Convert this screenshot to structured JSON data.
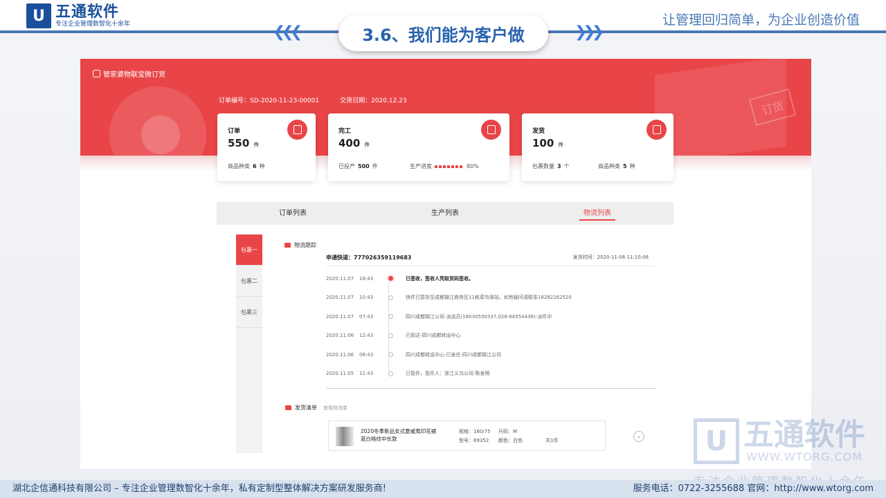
{
  "header": {
    "logo_mark": "U",
    "logo_name": "五通软件",
    "logo_sub": "专注企业管理数智化十余年",
    "slogan": "让管理回归简单，为企业创造价值",
    "title": "3.6、我们能为客户做",
    "chev_left": "❮❮❮",
    "chev_right": "❯❯❯"
  },
  "app": {
    "title": "管家婆物联宝微订货",
    "order_no": "订单编号：SD-2020-11-23-00001",
    "delivery_date": "交货日期：2020.12.23",
    "deco_tag": "订货",
    "cards": [
      {
        "label": "订单",
        "value": "550",
        "unit": "件",
        "sub1_label": "商品种类",
        "sub1_value": "6",
        "sub1_unit": "种",
        "icon": "order-icon"
      },
      {
        "label": "完工",
        "value": "400",
        "unit": "件",
        "sub1_label": "已投产",
        "sub1_value": "500",
        "sub1_unit": "件",
        "sub2_label": "生产进度",
        "progress": "80%",
        "icon": "production-icon"
      },
      {
        "label": "发货",
        "value": "100",
        "unit": "件",
        "sub1_label": "包裹数量",
        "sub1_value": "3",
        "sub1_unit": "个",
        "sub2_label": "商品种类",
        "sub2_value": "5",
        "sub2_unit": "种",
        "icon": "shipping-icon"
      }
    ],
    "tabs": [
      "订单列表",
      "生产列表",
      "物流列表"
    ],
    "packages": [
      "包裹一",
      "包裹二",
      "包裹三"
    ],
    "logistics_title": "物流跟踪",
    "express": "申通快递：777026359119683",
    "ship_time": "发货时间：2020-11-06 11:10:06",
    "tracking": [
      {
        "date": "2020.11.07",
        "time": "18:43",
        "text": "已签收，签收人凭取货码签收。"
      },
      {
        "date": "2020.11.07",
        "time": "10:43",
        "text": "快件已暂存至成都锦江商务区11栋菜鸟驿站，如有疑问请联系18282262520"
      },
      {
        "date": "2020.11.07",
        "time": "07:43",
        "text": "四川成都锦江公司-派送员(18030550337,028-64554438)-派件中"
      },
      {
        "date": "2020.11.06",
        "time": "12:43",
        "text": "已到达-四川成都转运中心"
      },
      {
        "date": "2020.11.06",
        "time": "08:43",
        "text": "四川成都转运中心-已发往-四川成都锦江公司"
      },
      {
        "date": "2020.11.05",
        "time": "11:43",
        "text": "已揽件，揽件人：浙江义乌公司-陈发明"
      }
    ],
    "goods_title": "发货清单",
    "goods_sub": "查看物流单",
    "goods": {
      "name": "2020冬季新品女式夏威夷印花裙 蓝白格纹中长款",
      "spec1": "规格：160/75",
      "spec2": "尺码：M",
      "model": "型号：69352",
      "color": "颜色：白色",
      "qty": "共1件"
    }
  },
  "watermark": {
    "mark": "U",
    "name": "五通软件",
    "url": "WWW.WTORG.COM",
    "sub": "专注企业管理数智化十余年"
  },
  "footer": {
    "left": "湖北企信通科技有限公司 – 专注企业管理数智化十余年，私有定制型整体解决方案研发服务商!",
    "right": "服务电话：0722-3255688  官网：http://www.wtorg.com"
  }
}
